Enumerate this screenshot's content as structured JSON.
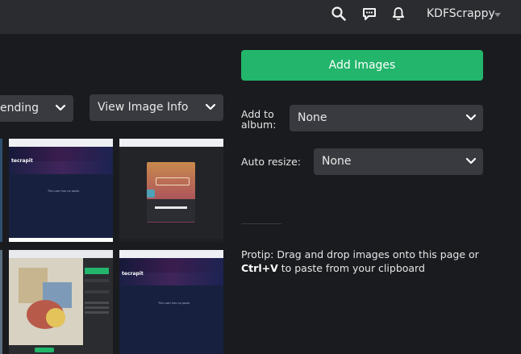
{
  "header": {
    "username": "KDFScrappy",
    "icons": [
      "search-icon",
      "chat-icon",
      "bell-icon",
      "caret-down-icon"
    ]
  },
  "toolbar": {
    "sort_label": "ending",
    "view_info_label": "View Image Info"
  },
  "upload": {
    "add_images_label": "Add Images",
    "add_to_album_label": "Add to album:",
    "album_value": "None",
    "auto_resize_label": "Auto resize:",
    "resize_value": "None"
  },
  "protip": {
    "prefix": "Protip: Drag and drop images onto this page or",
    "shortcut": "Ctrl+V",
    "suffix": " to paste from your clipboard"
  },
  "thumbs": {
    "t1_logo": "tecrapit",
    "t3_logo": "tecrapit",
    "t1_empty": "This user has no posts",
    "t3_empty": "This user has no posts"
  },
  "colors": {
    "accent_green": "#22b56b",
    "topbar": "#2b2c30",
    "background": "#1a1b1e",
    "dropdown": "#393a3f"
  }
}
